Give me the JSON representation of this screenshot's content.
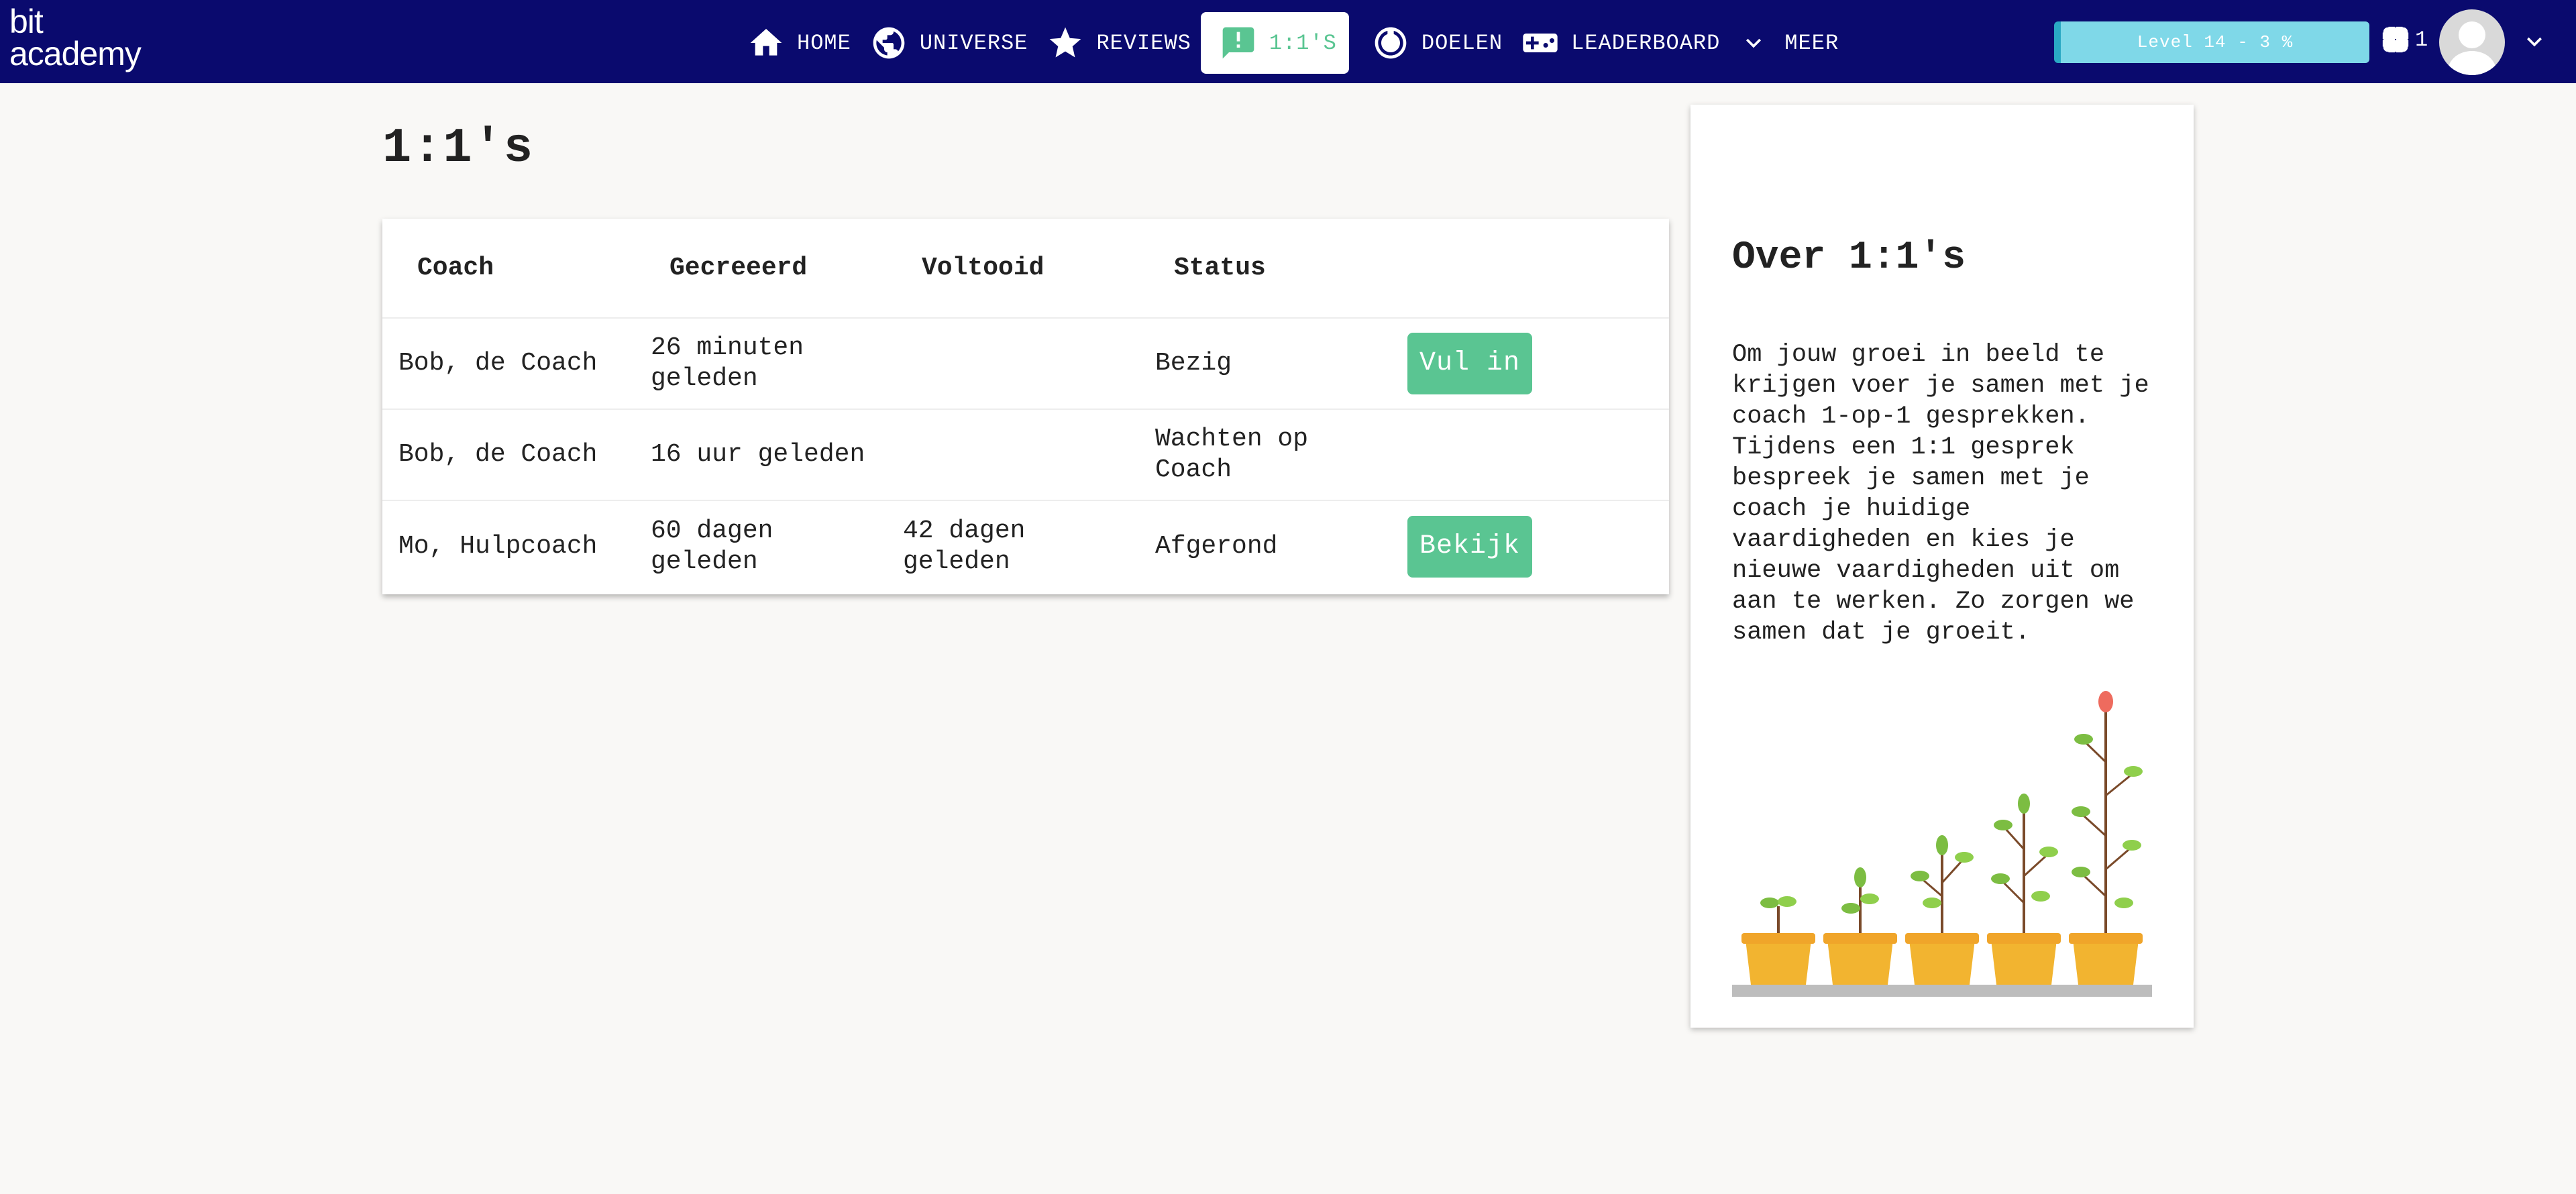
{
  "app": {
    "logo_line1": "bit",
    "logo_line2": "academy"
  },
  "nav": {
    "items": [
      {
        "label": "HOME",
        "icon": "home-icon"
      },
      {
        "label": "UNIVERSE",
        "icon": "globe-icon"
      },
      {
        "label": "REVIEWS",
        "icon": "star-icon"
      },
      {
        "label": "1:1'S",
        "icon": "chat-alert-icon",
        "active": true
      },
      {
        "label": "DOELEN",
        "icon": "target-icon"
      },
      {
        "label": "LEADERBOARD",
        "icon": "gamepad-icon"
      },
      {
        "label": "MEER",
        "icon": "chevron-down-icon"
      }
    ],
    "level": "Level 14 - 3 %",
    "chip_count": "1"
  },
  "page": {
    "title": "1:1's",
    "table": {
      "headers": [
        "Coach",
        "Gecreeerd",
        "Voltooid",
        "Status"
      ],
      "rows": [
        {
          "coach": "Bob, de Coach",
          "created": "26 minuten geleden",
          "completed": "",
          "status": "Bezig",
          "action": "Vul in"
        },
        {
          "coach": "Bob, de Coach",
          "created": "16 uur geleden",
          "completed": "",
          "status": "Wachten op Coach",
          "action": ""
        },
        {
          "coach": "Mo, Hulpcoach",
          "created": "60 dagen geleden",
          "completed": "42 dagen geleden",
          "status": "Afgerond",
          "action": "Bekijk"
        }
      ]
    }
  },
  "sidebar": {
    "title": "Over 1:1's",
    "text": "Om jouw groei in beeld te krijgen voer je samen met je coach 1-op-1 gesprekken. Tijdens een 1:1 gesprek bespreek je samen met je coach je huidige vaardigheden en kies je nieuwe vaardigheden uit om aan te werken. Zo zorgen we samen dat je groeit."
  },
  "colors": {
    "nav_bg": "#0a0a6e",
    "accent": "#5ac592",
    "level_bar": "#7fd8e8"
  }
}
